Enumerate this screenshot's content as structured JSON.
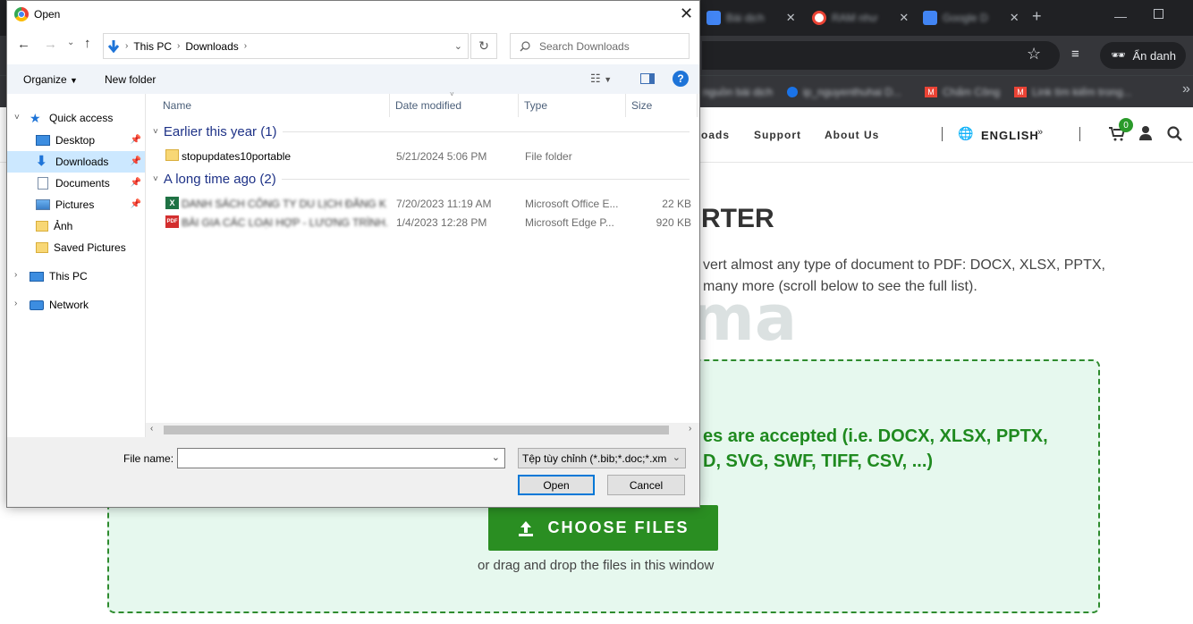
{
  "browser": {
    "tabs": [
      {
        "label": "Bài dịch",
        "icon": "docs-icon",
        "color": "#4285f4"
      },
      {
        "label": "RAM như",
        "icon": "google-icon",
        "color": "#ffffff"
      },
      {
        "label": "Google D",
        "icon": "translate-icon",
        "color": "#4285f4"
      }
    ],
    "new_tab": "+",
    "incognito_label": "Ẩn danh",
    "bookmarks": [
      {
        "label": "nguồn bài dịch",
        "icon": "folder-icon"
      },
      {
        "label": "ip_nguyenthuhai D...",
        "icon": "globe-icon"
      },
      {
        "label": "Chấm Công",
        "icon": "gmail-icon"
      },
      {
        "label": "Link tìm kiếm trong...",
        "icon": "gmail-icon"
      }
    ],
    "more_bookmarks": "»"
  },
  "site": {
    "nav": [
      "oads",
      "Support",
      "About Us"
    ],
    "language": "ENGLISH",
    "cart_count": "0",
    "hero_title": "RTER",
    "hero_line1": "vert almost any type of document to PDF: DOCX, XLSX, PPTX,",
    "hero_line2": "many more (scroll below to see the full list).",
    "accept_line1": "es are accepted (i.e. DOCX, XLSX, PPTX,",
    "accept_line2": "D, SVG, SWF, TIFF, CSV, ...)",
    "choose_files": "CHOOSE FILES",
    "drag_text": "or drag and drop the files in this window",
    "watermark": "uantrimang"
  },
  "dialog": {
    "title": "Open",
    "breadcrumb": [
      "This PC",
      "Downloads"
    ],
    "search_placeholder": "Search Downloads",
    "organize": "Organize",
    "new_folder": "New folder",
    "nav": {
      "quick_access": "Quick access",
      "items": [
        {
          "label": "Desktop",
          "pinned": true
        },
        {
          "label": "Downloads",
          "pinned": true,
          "selected": true
        },
        {
          "label": "Documents",
          "pinned": true
        },
        {
          "label": "Pictures",
          "pinned": true
        },
        {
          "label": "Ảnh",
          "pinned": false
        },
        {
          "label": "Saved Pictures",
          "pinned": false
        }
      ],
      "this_pc": "This PC",
      "network": "Network"
    },
    "columns": [
      "Name",
      "Date modified",
      "Type",
      "Size"
    ],
    "groups": [
      {
        "label": "Earlier this year (1)",
        "files": [
          {
            "name": "stopupdates10portable",
            "date": "5/21/2024 5:06 PM",
            "type": "File folder",
            "size": "",
            "icon": "folder-icon"
          }
        ]
      },
      {
        "label": "A long time ago (2)",
        "files": [
          {
            "name": "DANH SÁCH CÔNG TY DU LỊCH ĐĂNG K...",
            "date": "7/20/2023 11:19 AM",
            "type": "Microsoft Office E...",
            "size": "22 KB",
            "icon": "excel-icon"
          },
          {
            "name": "BÀI GIA CÁC LOẠI HỢP - LƯƠNG TRÌNH...",
            "date": "1/4/2023 12:28 PM",
            "type": "Microsoft Edge P...",
            "size": "920 KB",
            "icon": "pdf-icon"
          }
        ]
      }
    ],
    "file_name_label": "File name:",
    "file_name_value": "",
    "file_type": "Tệp tùy chỉnh (*.bib;*.doc;*.xm",
    "open_label": "Open",
    "cancel_label": "Cancel"
  }
}
